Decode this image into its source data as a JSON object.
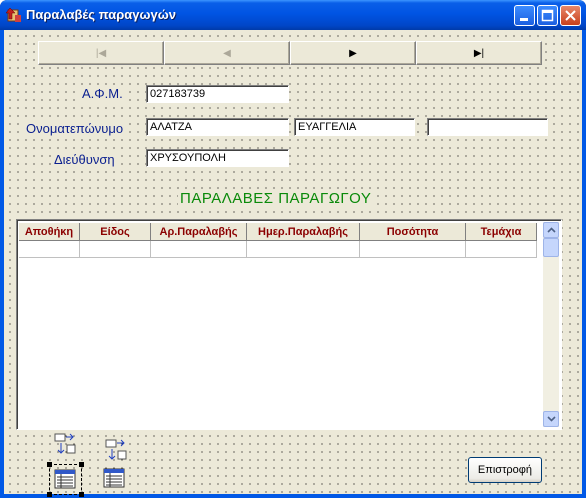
{
  "window": {
    "title": "Παραλαβές παραγωγών"
  },
  "nav": {
    "first": "|◀",
    "prev": "◀",
    "next": "▶",
    "last": "▶|"
  },
  "labels": {
    "afm": "Α.Φ.Μ.",
    "name": "Ονοματεπώνυμο",
    "address": "Διεύθυνση"
  },
  "fields": {
    "afm": "027183739",
    "surname": "ΑΛΑΤΖΑ",
    "firstname": "ΕΥΑΓΓΕΛΙΑ",
    "extra": "",
    "address": "ΧΡΥΣΟΥΠΟΛΗ"
  },
  "heading": "ΠΑΡΑΛΑΒΕΣ ΠΑΡΑΓΩΓΟΥ",
  "grid": {
    "columns": [
      "Αποθήκη",
      "Είδος",
      "Αρ.Παραλαβής",
      "Ημερ.Παραλαβής",
      "Ποσότητα",
      "Τεμάχια"
    ],
    "rows": []
  },
  "buttons": {
    "back": "Επιστροφή"
  },
  "colors": {
    "label": "#0a1f8f",
    "heading": "#0a8a0a",
    "header_text": "#8b0000"
  }
}
